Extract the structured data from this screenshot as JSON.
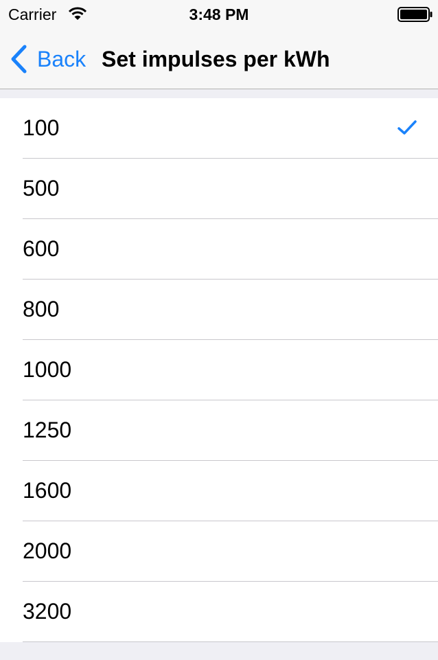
{
  "status_bar": {
    "carrier": "Carrier",
    "time": "3:48 PM",
    "icons": [
      "wifi-icon",
      "battery-icon"
    ]
  },
  "nav": {
    "back_label": "Back",
    "title": "Set impulses per kWh"
  },
  "options": [
    "100",
    "500",
    "600",
    "800",
    "1000",
    "1250",
    "1600",
    "2000",
    "3200"
  ],
  "selected": "100",
  "colors": {
    "accent": "#1a82fb",
    "background": "#efeff4",
    "bar": "#f7f7f7",
    "separator": "#c8c7cc"
  }
}
